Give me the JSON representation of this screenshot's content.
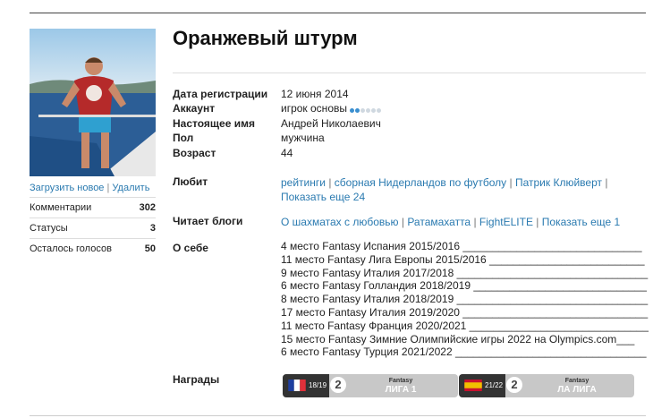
{
  "profile": {
    "name": "Оранжевый штурм",
    "avatar_links": {
      "upload": "Загрузить новое",
      "separator": "|",
      "delete": "Удалить"
    },
    "stats": [
      {
        "label": "Комментарии",
        "value": "302"
      },
      {
        "label": "Статусы",
        "value": "3"
      },
      {
        "label": "Осталось голосов",
        "value": "50"
      }
    ]
  },
  "info": {
    "rows": [
      {
        "label": "Дата регистрации",
        "value": "12 июня 2014"
      },
      {
        "label": "Аккаунт",
        "value": "игрок основы"
      },
      {
        "label": "Настоящее имя",
        "value": "Андрей Николаевич"
      },
      {
        "label": "Пол",
        "value": "мужчина"
      },
      {
        "label": "Возраст",
        "value": "44"
      }
    ],
    "account_level_dots": {
      "filled": 2,
      "total": 6,
      "filled_color": "#3a8fd0",
      "empty_color": "#cfd8e0"
    }
  },
  "likes": {
    "label": "Любит",
    "items": [
      "рейтинги",
      "сборная Нидерландов по футболу",
      "Патрик Клюйверт"
    ],
    "separator": "|",
    "more": "Показать еще 24"
  },
  "blogs": {
    "label": "Читает блоги",
    "items": [
      "О шахматах с любовью",
      "Ратамахатта",
      "FightELITE"
    ],
    "more": "Показать еще 1"
  },
  "about": {
    "label": "О себе",
    "lines": [
      "4 место Fantasy Испания 2015/2016 ______________________________",
      "11 место Fantasy Лига Европы 2015/2016 __________________________",
      "9 место Fantasy Италия 2017/2018 ________________________________",
      "6 место Fantasy Голландия 2018/2019 _____________________________",
      "8 место Fantasy Италия 2018/2019 ________________________________",
      "17 место Fantasy Италия 2019/2020 _______________________________",
      "11 место Fantasy Франция 2020/2021 ______________________________",
      "15 место Fantasy Зимние Олимпийские игры 2022 на Olympics.com___",
      "6 место Fantasy Турция 2021/2022 ________________________________"
    ]
  },
  "awards": {
    "label": "Награды",
    "items": [
      {
        "fraction": "18/19",
        "place": "2",
        "small": "Fantasy",
        "big": "ЛИГА 1",
        "flag": "france-flag"
      },
      {
        "fraction": "21/22",
        "place": "2",
        "small": "Fantasy",
        "big": "ЛА ЛИГА",
        "flag": "spain-flag"
      }
    ]
  }
}
